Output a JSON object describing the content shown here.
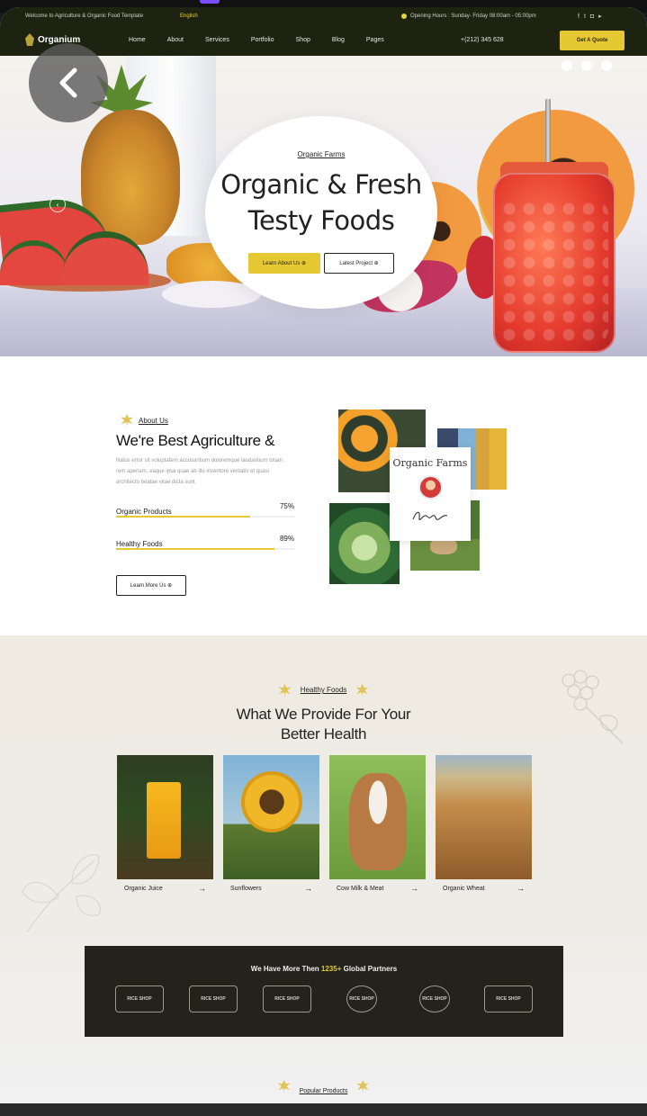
{
  "topbar": {
    "welcome": "Welcome to Agriculture & Organic Food Template",
    "language": "English",
    "hours": "Opening Hours : Sunday- Friday 08:00am - 05:00pm",
    "social_icons": [
      "facebook-icon",
      "twitter-icon",
      "instagram-icon",
      "youtube-icon"
    ]
  },
  "nav": {
    "logo": "Organium",
    "menu": [
      "Home",
      "About",
      "Services",
      "Portfolio",
      "Shop",
      "Blog",
      "Pages"
    ],
    "phone": "+(212) 345 628",
    "cta": "Get A Quote"
  },
  "hero": {
    "eyebrow": "Organic Farms",
    "title_line1": "Organic & Fresh",
    "title_line2": "Testy Foods",
    "primary_button": "Learn About Us",
    "secondary_button": "Latest Project"
  },
  "about": {
    "eyebrow": "About Us",
    "title": "We're Best Agriculture &",
    "description": "Natus error sit voluptatem accusantium doloremque laudantium totam rem aperiam, eaque ipsa quae ab illo inventore veritatis et quasi architecto beatae vitae dicta sunt",
    "skills": [
      {
        "label": "Organic Products",
        "percent_label": "75%",
        "value": 0.75
      },
      {
        "label": "Healthy Foods",
        "percent_label": "89%",
        "value": 0.89
      }
    ],
    "button": "Learn More Us",
    "card_title": "Organic Farms"
  },
  "healthy": {
    "eyebrow": "Healthy Foods",
    "title_line1": "What We Provide For Your",
    "title_line2": "Better Health",
    "items": [
      {
        "label": "Organic Juice"
      },
      {
        "label": "Sunflowers"
      },
      {
        "label": "Cow Milk & Meat"
      },
      {
        "label": "Organic Wheat"
      }
    ]
  },
  "partners": {
    "title_prefix": "We Have More Then",
    "count": "1235+",
    "title_suffix": "Global Partners",
    "logos": [
      "RICE SHOP",
      "RICE SHOP",
      "RICE SHOP",
      "RICE SHOP",
      "RICE SHOP",
      "RICE SHOP"
    ]
  },
  "popular": {
    "eyebrow": "Popular Products"
  },
  "colors": {
    "accent": "#e6c833",
    "dark": "#1e2210"
  }
}
